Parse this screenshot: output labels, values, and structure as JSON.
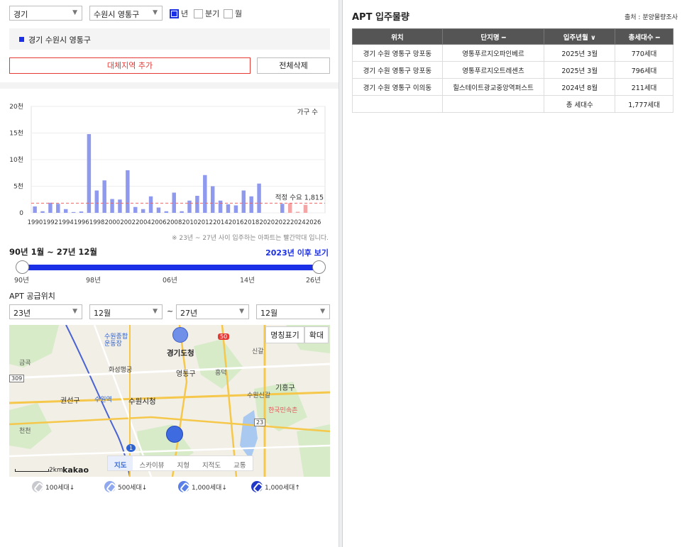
{
  "filters": {
    "province": "경기",
    "city": "수원시 영통구",
    "period_options": [
      {
        "label": "년",
        "checked": true
      },
      {
        "label": "분기",
        "checked": false
      },
      {
        "label": "월",
        "checked": false
      }
    ]
  },
  "region_list": [
    "경기 수원시 영통구"
  ],
  "buttons": {
    "add_region": "대체지역 추가",
    "delete_all": "전체삭제"
  },
  "chart_data": {
    "type": "bar",
    "legend": "가구 수",
    "categories": [
      "1990",
      "1991",
      "1992",
      "1993",
      "1994",
      "1995",
      "1996",
      "1997",
      "1998",
      "1999",
      "2000",
      "2001",
      "2002",
      "2003",
      "2004",
      "2005",
      "2006",
      "2007",
      "2008",
      "2009",
      "2010",
      "2011",
      "2012",
      "2013",
      "2014",
      "2015",
      "2016",
      "2017",
      "2018",
      "2019",
      "2020",
      "2021",
      "2022",
      "2023",
      "2024",
      "2025",
      "2026",
      "2027"
    ],
    "x_tick_labels": [
      "1990",
      "1992",
      "1994",
      "1996",
      "1998",
      "2000",
      "2002",
      "2004",
      "2006",
      "2008",
      "2010",
      "2012",
      "2014",
      "2016",
      "2018",
      "2020",
      "2022",
      "2024",
      "2026"
    ],
    "y_tick_labels": [
      "0",
      "5천",
      "10천",
      "15천",
      "20천"
    ],
    "values": [
      1200,
      300,
      1900,
      1700,
      700,
      150,
      250,
      14800,
      4200,
      6100,
      2600,
      2500,
      8000,
      1100,
      700,
      3100,
      1000,
      300,
      3800,
      300,
      2300,
      3200,
      7100,
      5000,
      2300,
      1600,
      1400,
      4200,
      3100,
      5500,
      0,
      0,
      1700,
      1800,
      200,
      1500,
      0,
      0
    ],
    "highlight_from": "2023",
    "ylim": [
      0,
      20000
    ],
    "reference_line": {
      "label": "적정 수요 1,815",
      "value": 1815
    },
    "note": "※ 23년 ~ 27년 사이 입주하는 아파트는 빨간막대 입니다.",
    "colors": {
      "normal": "#8f99ee",
      "future": "#f4a5a5",
      "reference": "#f06464"
    }
  },
  "range": {
    "title": "90년 1월 ~ 27년 12월",
    "link": "2023년 이후 보기",
    "ticks": [
      "90년",
      "98년",
      "06년",
      "14년",
      "26년"
    ]
  },
  "supply": {
    "title": "APT 공급위치",
    "from_year": "23년",
    "from_month": "12월",
    "tilde": "~",
    "to_year": "27년",
    "to_month": "12월"
  },
  "map": {
    "buttons": [
      "명칭표기",
      "확대"
    ],
    "tabs": [
      {
        "label": "지도",
        "active": true
      },
      {
        "label": "스카이뷰",
        "active": false
      },
      {
        "label": "지형",
        "active": false
      },
      {
        "label": "지적도",
        "active": false
      },
      {
        "label": "교통",
        "active": false
      }
    ],
    "scale": "2km",
    "logo": "kakao",
    "labels": [
      "수원종합운동장",
      "경기도청",
      "화성행궁",
      "영통구",
      "권선구",
      "수원역",
      "수원시청",
      "기흥구",
      "한국민속촌",
      "신갈",
      "수원신갈",
      "흥덕",
      "금곡",
      "천천",
      "50",
      "309",
      "23",
      "1"
    ]
  },
  "legend": [
    "100세대↓",
    "500세대↓",
    "1,000세대↓",
    "1,000세대↑"
  ],
  "right": {
    "title": "APT 입주물량",
    "source": "출처 : 분양물량조사",
    "columns": [
      "위치",
      "단지명 ━",
      "입주년월 ∨",
      "총세대수 ━"
    ],
    "rows": [
      [
        "경기 수원 영통구 망포동",
        "영통푸르지오파인베르",
        "2025년 3월",
        "770세대"
      ],
      [
        "경기 수원 영통구 망포동",
        "영통푸르지오트레센츠",
        "2025년 3월",
        "796세대"
      ],
      [
        "경기 수원 영통구 이의동",
        "힐스테이트광교중앙역퍼스트",
        "2024년 8월",
        "211세대"
      ]
    ],
    "total_label": "총 세대수",
    "total_value": "1,777세대"
  }
}
